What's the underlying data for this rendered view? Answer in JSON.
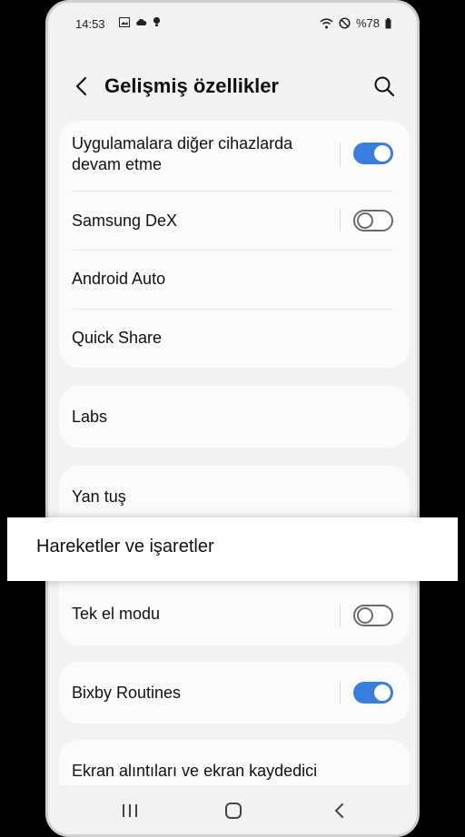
{
  "status_bar": {
    "time": "14:53",
    "battery": "%78",
    "icons": [
      "gallery-icon",
      "cloud-icon",
      "bulb-icon",
      "wifi-icon",
      "do-not-disturb-icon",
      "battery-icon"
    ]
  },
  "header": {
    "title": "Gelişmiş özellikler",
    "back_icon": "chevron-left-icon",
    "search_icon": "search-icon"
  },
  "settings": {
    "continue_apps": {
      "label_line1": "Uygulamalara diğer cihazlarda",
      "label_line2": "devam etme",
      "enabled": true
    },
    "samsung_dex": {
      "label": "Samsung DeX",
      "enabled": false
    },
    "android_auto": {
      "label": "Android Auto"
    },
    "quick_share": {
      "label": "Quick Share"
    },
    "labs": {
      "label": "Labs"
    },
    "side_key": {
      "label": "Yan tuş"
    },
    "motions": {
      "label": "Hareketler ve işaretler"
    },
    "one_hand": {
      "label": "Tek el modu",
      "enabled": false
    },
    "bixby_routines": {
      "label": "Bixby Routines",
      "enabled": true
    },
    "screenshots": {
      "label": "Ekran alıntıları ve ekran kaydedici"
    }
  },
  "nav_bar": {
    "recents_icon": "recents-icon",
    "home_icon": "home-icon",
    "back_icon": "back-icon"
  },
  "colors": {
    "accent": "#3a7de0",
    "background": "#f2f2f2",
    "card": "#fbfbfb"
  }
}
